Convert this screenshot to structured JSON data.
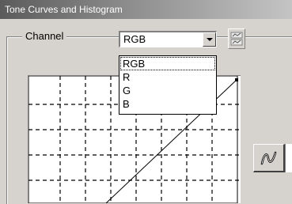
{
  "window": {
    "title": "Tone Curves and Histogram"
  },
  "channel": {
    "label": "Channel",
    "selected": "RGB",
    "options": [
      "RGB",
      "R",
      "G",
      "B"
    ],
    "highlighted_index": 0
  },
  "icons": {
    "dropdown_arrow": "chevron-down-icon",
    "tool_button": "save-load-curve-icon",
    "curve_mode": "freehand-curve-icon"
  },
  "colors": {
    "face": "#d6d3ce",
    "curve_line": "#000000",
    "grid": "#000000",
    "title_gradient_start": "#5b5b5b"
  }
}
